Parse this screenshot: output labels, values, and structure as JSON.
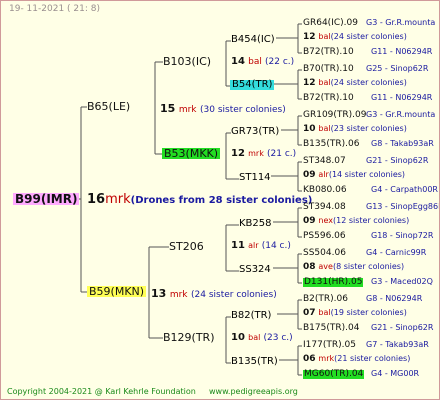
{
  "header": "19- 11-2021 ( 21: 8)",
  "colors": {
    "line": "#555555",
    "highlight_yellow": "#ffff55",
    "highlight_green": "#22dd22",
    "highlight_cyan": "#33dddd",
    "drone_highlight": "#ffaaff"
  },
  "root": {
    "label": "B99(IMR)",
    "count": "16",
    "br": "mrk",
    "note": "(Drones from 28 sister colonies)"
  },
  "gen1": [
    {
      "label": "B65(LE)",
      "count": "15",
      "br": "mrk",
      "note": "(30 sister colonies)"
    },
    {
      "label": "B59(MKN)",
      "count": "13",
      "br": "mrk",
      "note": "(24 sister colonies)"
    }
  ],
  "gen2": [
    {
      "label": "B103(IC)",
      "count": "14",
      "br": "bal",
      "note": "(22 c.)"
    },
    {
      "label": "B53(MKK)",
      "count": "12",
      "br": "mrk",
      "note": "(21 c.)"
    },
    {
      "label": "ST206",
      "count": "11",
      "br": "alr",
      "note": "(14 c.)"
    },
    {
      "label": "B129(TR)",
      "count": "10",
      "br": "bal",
      "note": "(23 c.)"
    }
  ],
  "gen3": [
    {
      "label": "B454(IC)"
    },
    {
      "label": "B54(TR)"
    },
    {
      "label": "GR73(TR)"
    },
    {
      "label": "ST114"
    },
    {
      "label": "KB258"
    },
    {
      "label": "SS324"
    },
    {
      "label": "B82(TR)"
    },
    {
      "label": "B135(TR)"
    }
  ],
  "gen4": [
    {
      "top": "GR64(IC).09",
      "top_ped": "G3 - Gr.R.mounta",
      "count": "12",
      "br": "bal",
      "note": "(24 sister colonies)",
      "bot": "B72(TR).10",
      "bot_ped": "G11 - N06294R"
    },
    {
      "top": "B70(TR).10",
      "top_ped": "G25 - Sinop62R",
      "count": "12",
      "br": "bal",
      "note": "(24 sister colonies)",
      "bot": "B72(TR).10",
      "bot_ped": "G11 - N06294R"
    },
    {
      "top": "GR109(TR).09",
      "top_ped": "G3 - Gr.R.mounta",
      "count": "10",
      "br": "bal",
      "note": "(23 sister colonies)",
      "bot": "B135(TR).06",
      "bot_ped": "G8 - Takab93aR"
    },
    {
      "top": "ST348.07",
      "top_ped": "G21 - Sinop62R",
      "count": "09",
      "br": "alr",
      "note": "(14 sister colonies)",
      "bot": "KB080.06",
      "bot_ped": "G4 - Carpath00R"
    },
    {
      "top": "ST394.08",
      "top_ped": "G13 - SinopEgg86R",
      "count": "09",
      "br": "nex",
      "note": "(12 sister colonies)",
      "bot": "PS596.06",
      "bot_ped": "G18 - Sinop72R"
    },
    {
      "top": "SS504.06",
      "top_ped": "G4 - Carnic99R",
      "count": "08",
      "br": "ave",
      "note": "(8 sister colonies)",
      "bot": "D131(HR).05",
      "bot_ped": "G3 - Maced02Q"
    },
    {
      "top": "B2(TR).06",
      "top_ped": "G8 - N06294R",
      "count": "07",
      "br": "bal",
      "note": "(19 sister colonies)",
      "bot": "B175(TR).04",
      "bot_ped": "G21 - Sinop62R"
    },
    {
      "top": "I177(TR).05",
      "top_ped": "G7 - Takab93aR",
      "count": "06",
      "br": "mrk",
      "note": "(21 sister colonies)",
      "bot": "MG60(TR).04",
      "bot_ped": "G4 - MG00R"
    }
  ],
  "footer": {
    "copyright": "Copyright 2004-2021 @ Karl Kehrle Foundation",
    "site": "www.pedigreeapis.org"
  }
}
